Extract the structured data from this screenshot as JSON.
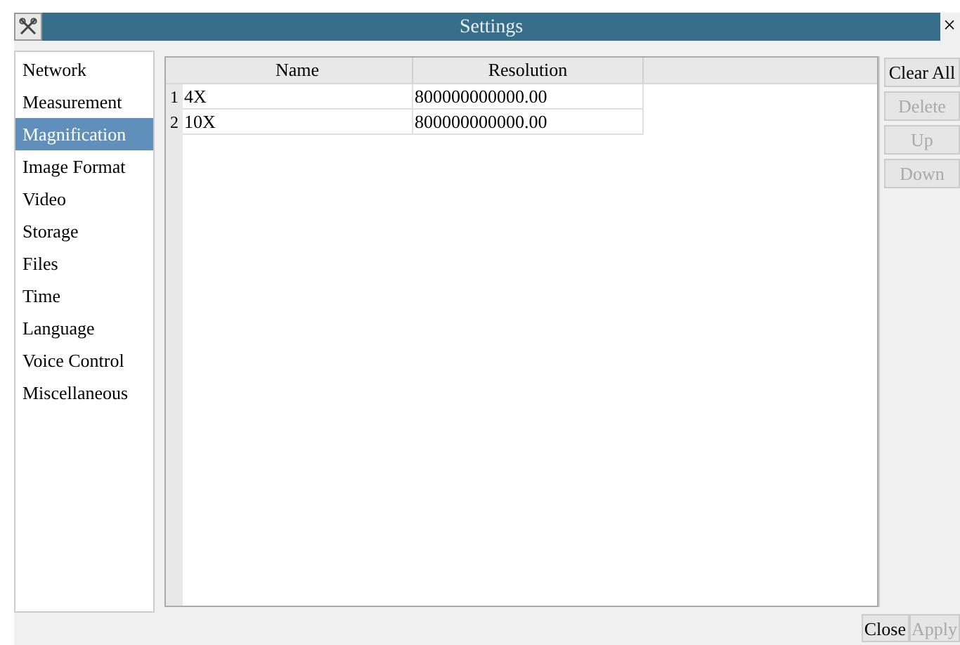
{
  "window": {
    "title": "Settings",
    "close": "×"
  },
  "sidebar": {
    "items": [
      {
        "label": "Network",
        "selected": false
      },
      {
        "label": "Measurement",
        "selected": false
      },
      {
        "label": "Magnification",
        "selected": true
      },
      {
        "label": "Image Format",
        "selected": false
      },
      {
        "label": "Video",
        "selected": false
      },
      {
        "label": "Storage",
        "selected": false
      },
      {
        "label": "Files",
        "selected": false
      },
      {
        "label": "Time",
        "selected": false
      },
      {
        "label": "Language",
        "selected": false
      },
      {
        "label": "Voice Control",
        "selected": false
      },
      {
        "label": "Miscellaneous",
        "selected": false
      }
    ]
  },
  "table": {
    "columns": [
      "Name",
      "Resolution"
    ],
    "rows": [
      {
        "index": "1",
        "cells": [
          "4X",
          "800000000000.00"
        ]
      },
      {
        "index": "2",
        "cells": [
          "10X",
          "800000000000.00"
        ]
      }
    ]
  },
  "side_buttons": [
    {
      "label": "Clear All",
      "disabled": false
    },
    {
      "label": "Delete",
      "disabled": true
    },
    {
      "label": "Up",
      "disabled": true
    },
    {
      "label": "Down",
      "disabled": true
    }
  ],
  "footer_buttons": [
    {
      "label": "Close",
      "disabled": false
    },
    {
      "label": "Apply",
      "disabled": true
    }
  ]
}
